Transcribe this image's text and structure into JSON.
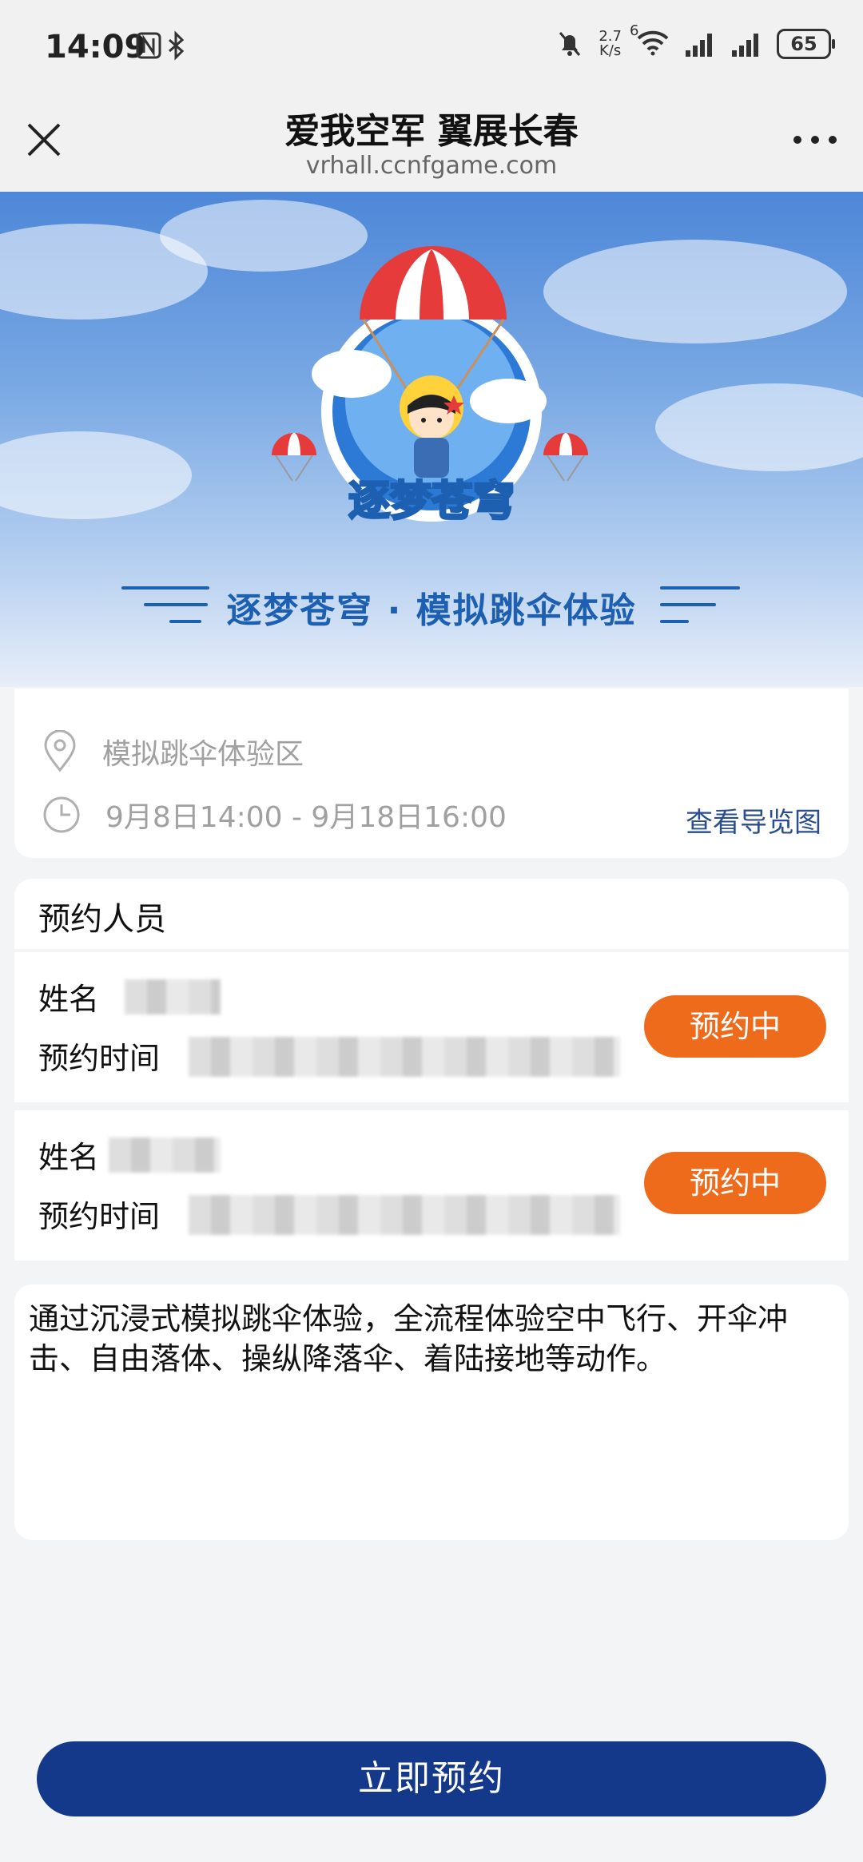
{
  "status_bar": {
    "time": "14:09",
    "net_speed_value": "2.7",
    "net_speed_unit": "K/s",
    "battery": "65",
    "network_badge": "6"
  },
  "title_bar": {
    "title": "爱我空军 翼展长春",
    "url": "vrhall.ccnfgame.com"
  },
  "banner": {
    "logo_text": "逐梦苍穹",
    "headline": "逐梦苍穹 · 模拟跳伞体验"
  },
  "info": {
    "location": "模拟跳伞体验区",
    "time_range": "9月8日14:00 - 9月18日16:00",
    "map_link": "查看导览图"
  },
  "people": {
    "title": "预约人员",
    "name_label": "姓名",
    "time_label": "预约时间",
    "entries": [
      {
        "status": "预约中"
      },
      {
        "status": "预约中"
      }
    ]
  },
  "description": "通过沉浸式模拟跳伞体验，全流程体验空中飞行、开伞冲击、自由落体、操纵降落伞、着陆接地等动作。",
  "actions": {
    "book_now": "立即预约"
  },
  "colors": {
    "accent_blue": "#14398a",
    "status_orange": "#ee6b1c",
    "link_blue": "#2a4d8f"
  }
}
